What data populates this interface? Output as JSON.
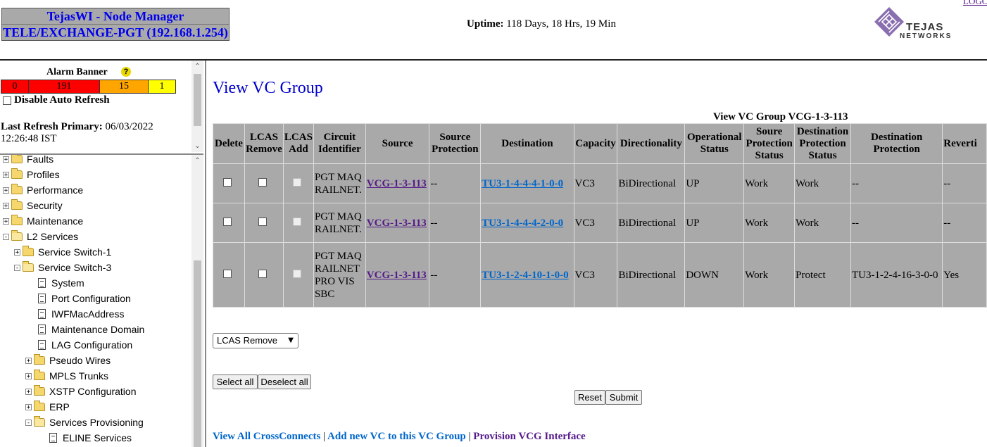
{
  "header": {
    "app_title": "TejasWI - Node Manager",
    "node_name": "TELE/EXCHANGE-PGT (192.168.1.254)",
    "uptime_label": "Uptime:",
    "uptime_value": "118 Days, 18 Hrs, 19 Min",
    "logo_word1": "TEJAS",
    "logo_word2": "NETWORKS",
    "logout_label": "LOGO"
  },
  "alarm": {
    "title": "Alarm Banner",
    "help_icon": "question-icon",
    "counts": [
      {
        "value": "0",
        "color": "#ff0000"
      },
      {
        "value": "191",
        "color": "#ff0000"
      },
      {
        "value": "15",
        "color": "#ffa500"
      },
      {
        "value": "1",
        "color": "#ffff00"
      }
    ],
    "auto_refresh_label": "Disable Auto Refresh",
    "last_refresh_label": "Last Refresh Primary:",
    "last_refresh_date": "06/03/2022",
    "last_refresh_time": "12:26:48 IST"
  },
  "tree": {
    "items": [
      {
        "label": "Faults",
        "expander": "+",
        "icon": "folder-icon"
      },
      {
        "label": "Profiles",
        "expander": "+",
        "icon": "folder-icon"
      },
      {
        "label": "Performance",
        "expander": "+",
        "icon": "folder-icon"
      },
      {
        "label": "Security",
        "expander": "+",
        "icon": "folder-icon"
      },
      {
        "label": "Maintenance",
        "expander": "+",
        "icon": "folder-icon"
      },
      {
        "label": "L2 Services",
        "expander": "-",
        "icon": "folder-open-icon"
      },
      {
        "label": "Service Switch-1",
        "expander": "+",
        "icon": "folder-icon"
      },
      {
        "label": "Service Switch-3",
        "expander": "-",
        "icon": "folder-open-icon"
      },
      {
        "label": "System",
        "expander": "",
        "icon": "document-icon"
      },
      {
        "label": "Port Configuration",
        "expander": "",
        "icon": "document-icon"
      },
      {
        "label": "IWFMacAddress",
        "expander": "",
        "icon": "document-icon"
      },
      {
        "label": "Maintenance Domain",
        "expander": "",
        "icon": "document-icon"
      },
      {
        "label": "LAG Configuration",
        "expander": "",
        "icon": "document-icon"
      },
      {
        "label": "Pseudo Wires",
        "expander": "+",
        "icon": "folder-icon"
      },
      {
        "label": "MPLS Trunks",
        "expander": "+",
        "icon": "folder-icon"
      },
      {
        "label": "XSTP Configuration",
        "expander": "+",
        "icon": "folder-icon"
      },
      {
        "label": "ERP",
        "expander": "+",
        "icon": "folder-icon"
      },
      {
        "label": "Services Provisioning",
        "expander": "-",
        "icon": "folder-open-icon"
      },
      {
        "label": "ELINE Services",
        "expander": "",
        "icon": "document-icon"
      }
    ]
  },
  "main": {
    "page_title": "View VC Group",
    "table_caption": "View VC Group VCG-1-3-113",
    "columns": [
      "Delete",
      "LCAS Remove",
      "LCAS Add",
      "Circuit Identifier",
      "Source",
      "Source Protection",
      "Destination",
      "Capacity",
      "Directionality",
      "Operational Status",
      "Soure Protection Status",
      "Destination Protection Status",
      "Destination Protection",
      "Reverti"
    ],
    "rows": [
      {
        "circuit": "PGT MAQ RAILNET.",
        "source": "VCG-1-3-113",
        "source_protection": "--",
        "destination": "TU3-1-4-4-4-1-0-0",
        "capacity": "VC3",
        "directionality": "BiDirectional",
        "op_status": "UP",
        "src_prot_status": "Work",
        "dst_prot_status": "Work",
        "dst_protection": "--",
        "revertive": "--"
      },
      {
        "circuit": "PGT MAQ RAILNET.",
        "source": "VCG-1-3-113",
        "source_protection": "--",
        "destination": "TU3-1-4-4-4-2-0-0",
        "capacity": "VC3",
        "directionality": "BiDirectional",
        "op_status": "UP",
        "src_prot_status": "Work",
        "dst_prot_status": "Work",
        "dst_protection": "--",
        "revertive": "--"
      },
      {
        "circuit": "PGT MAQ RAILNET PRO VIS SBC",
        "source": "VCG-1-3-113",
        "source_protection": "--",
        "destination": "TU3-1-2-4-10-1-0-0",
        "capacity": "VC3",
        "directionality": "BiDirectional",
        "op_status": "DOWN",
        "src_prot_status": "Work",
        "dst_prot_status": "Protect",
        "dst_protection": "TU3-1-2-4-16-3-0-0",
        "revertive": "Yes"
      }
    ],
    "action_select": "LCAS Remove",
    "select_all_label": "Select all",
    "deselect_all_label": "Deselect all",
    "reset_label": "Reset",
    "submit_label": "Submit",
    "links": {
      "view_all": "View All CrossConnects",
      "add_vc": "Add new VC to this VC Group",
      "provision": "Provision VCG Interface"
    }
  }
}
